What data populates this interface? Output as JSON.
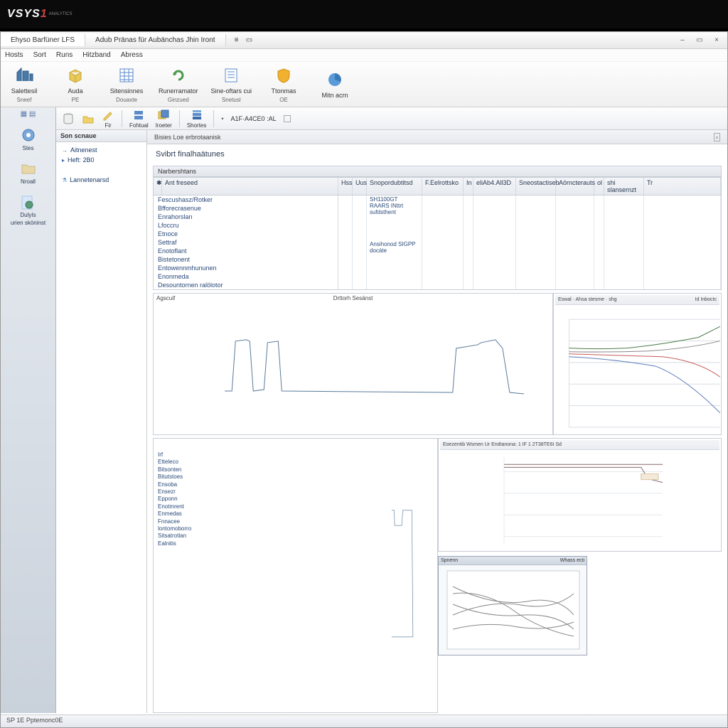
{
  "logo": "VSYS",
  "logo_suffix": "1",
  "logo_sub": "ANALYTICS",
  "window": {
    "tab1": "Ehyso Barfüner LFS",
    "tab2": "Adub Pränas für Aubänchas Jhin Iront",
    "minimize": "–",
    "restore": "▭",
    "close": "×"
  },
  "menu": {
    "m0": "Hosts",
    "m1": "Sort",
    "m2": "Runs",
    "m3": "Hitzband",
    "m4": "Abress"
  },
  "ribbon": {
    "r0": {
      "label": "Salettesil",
      "sub": "Sneef"
    },
    "r1": {
      "label": "Auda",
      "sub": "PE"
    },
    "r2": {
      "label": "Sitensinnes",
      "sub": "Douaxte"
    },
    "r3": {
      "label": "Runerramator",
      "sub": "Ginzued"
    },
    "r4": {
      "label": "Sine-oftars cui",
      "sub": "Snetusl"
    },
    "r5": {
      "label": "Ttonmas",
      "sub": "OE"
    },
    "r6": {
      "label": "Mitn acrn",
      "sub": ""
    }
  },
  "left_rail": {
    "i0": "Stes",
    "i1": "Nroall",
    "i2": "DulyIs",
    "i3": "urien sköninst"
  },
  "toolbar2": {
    "b0": "",
    "b1": "",
    "b2": "Fir",
    "b3": "Fohtual",
    "b4": "Iroeter",
    "b5": "Shortes",
    "dropdown": "A1F·A4CE0 :AL"
  },
  "tree": {
    "header": "Son scnaue",
    "n0": "Aitnenest",
    "n1": "Heft: 2B0",
    "n2": "Lannetenarsd"
  },
  "doc": {
    "tab": "Bisies Loe erbrotaanisk",
    "title": "Svibrt  finalhaätunes",
    "prop_section": "Narbershtans",
    "headers": {
      "h0": "Ant freseed",
      "h1": "Hss",
      "h2": "Uus",
      "h3": "Snopordubtitsd",
      "h4": "F.Eelrottsko",
      "h5": "In",
      "h6": "eliAb4.All3D",
      "h7": "Sneostactiseb",
      "h8": "Aörncterauts",
      "h9": "ol",
      "h10": "shi slansernzt",
      "h11": "Tr"
    },
    "rows": {
      "r0": "Fescushasz/Rotker",
      "r1": "Bfforecrasenue",
      "r2": "Enrahorslan",
      "r3": "Lfoccru",
      "r4": "Etnoce",
      "r5": "Settraf",
      "r6": "Enotoflant",
      "r7": "Bistetonent",
      "r8": "Entowennmhununen",
      "r9": "Enonmeda",
      "r10": "Desountornen ralölotor"
    },
    "vals": {
      "v0": "SH1100GT RAARS INttrt",
      "v1": "sufdsthent",
      "v2": "Ansihonod SIGPP docáte"
    },
    "chart1_title": "Drttorh Sesänst",
    "chart1_label": "Agscuif",
    "chart2_title": "Id Inboctc",
    "chart2_head": "Eswal · Ahsa stesme · shg",
    "chart3_title": "Eoezentib Wsmen Ur Endtanona: 1 IF  1 2T38TE6I Sd",
    "list2": {
      "l0": "Irf",
      "l1": "Etteleco",
      "l2": "Bitsonten",
      "l3": "Bitutstoes",
      "l4": "Ensoba",
      "l5": "Ensezr",
      "l6": "Epponn",
      "l7": "Enotmrent",
      "l8": "Enmedas",
      "l9": "Fnnacee",
      "l10": "lontomoborro",
      "l11": "Sitsatrotlan",
      "l12": "Ealnitis"
    },
    "thumb_head_l": "Spnenn",
    "thumb_head_r": "Whass ecti"
  },
  "status": "SP  1E Pptemonc0E"
}
